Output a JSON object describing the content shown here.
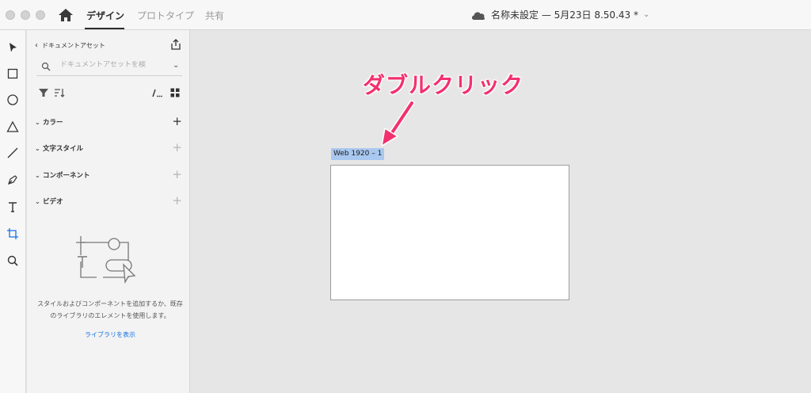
{
  "tabs": [
    {
      "label": "デザイン",
      "active": true
    },
    {
      "label": "プロトタイプ",
      "active": false
    },
    {
      "label": "共有",
      "active": false
    }
  ],
  "document": {
    "title": "名称未設定 — 5月23日 8.50.43 *"
  },
  "assets_panel": {
    "header": "ドキュメントアセット",
    "search_placeholder": "ドキュメントアセットを検",
    "sections": [
      {
        "label": "カラー"
      },
      {
        "label": "文字スタイル"
      },
      {
        "label": "コンポーネント"
      },
      {
        "label": "ビデオ"
      }
    ],
    "empty_message": "スタイルおよびコンポーネントを追加するか、既存のライブラリのエレメントを使用します。",
    "library_link": "ライブラリを表示"
  },
  "canvas": {
    "artboard_name": "Web 1920 – 1",
    "annotation": "ダブルクリック"
  },
  "colors": {
    "accent_link": "#1473e6",
    "annotation": "#f2316f",
    "selection": "#a9c8f0"
  },
  "icons": [
    "home-icon",
    "cloud-icon",
    "select-tool-icon",
    "rectangle-tool-icon",
    "ellipse-tool-icon",
    "polygon-tool-icon",
    "line-tool-icon",
    "pen-tool-icon",
    "text-tool-icon",
    "artboard-tool-icon",
    "zoom-tool-icon",
    "share-icon",
    "search-icon",
    "filter-icon",
    "sort-icon",
    "list-view-icon",
    "grid-view-icon"
  ]
}
